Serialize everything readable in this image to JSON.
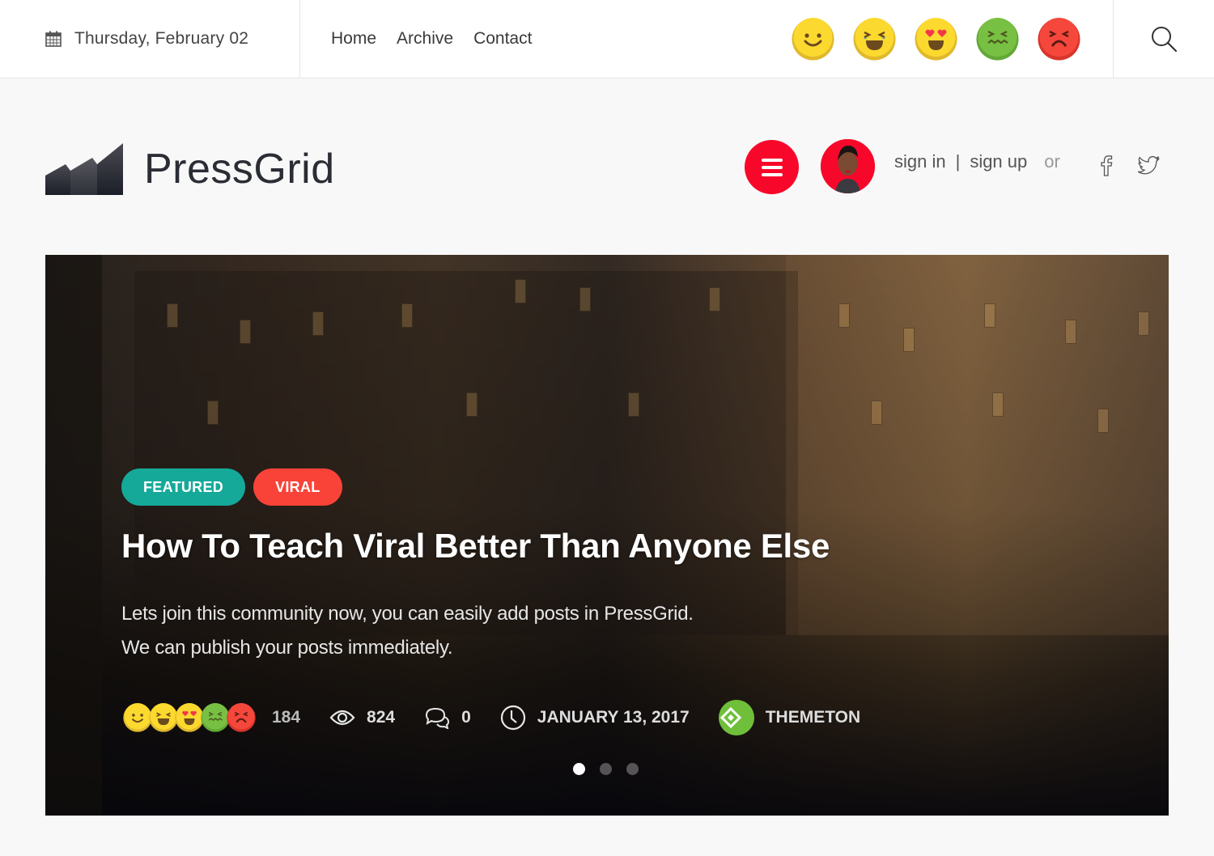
{
  "topbar": {
    "date": "Thursday, February 02",
    "nav": [
      {
        "label": "Home"
      },
      {
        "label": "Archive"
      },
      {
        "label": "Contact"
      }
    ],
    "reactions": [
      {
        "name": "smile",
        "color": "#fcd92e"
      },
      {
        "name": "laugh",
        "color": "#fcd92e"
      },
      {
        "name": "love",
        "color": "#fcd92e"
      },
      {
        "name": "sick",
        "color": "#78c043"
      },
      {
        "name": "angry",
        "color": "#f5473b"
      }
    ]
  },
  "header": {
    "logo_text": "PressGrid",
    "sign_in": "sign in",
    "separator": "|",
    "sign_up": "sign up",
    "or": "or",
    "accent_color": "#f7082a"
  },
  "hero": {
    "tags": [
      {
        "label": "FEATURED",
        "color": "#15a99a"
      },
      {
        "label": "VIRAL",
        "color": "#f94338"
      }
    ],
    "title": "How To Teach Viral Better Than Anyone Else",
    "description_lines": [
      "Lets join this community now, you can easily add posts in PressGrid.",
      "We can publish your posts immediately."
    ],
    "meta": {
      "reactions_count": "184",
      "views": "824",
      "comments": "0",
      "date": "JANUARY 13, 2017",
      "author": "THEMETON"
    },
    "slider": {
      "total": 3,
      "active_index": 0
    }
  }
}
